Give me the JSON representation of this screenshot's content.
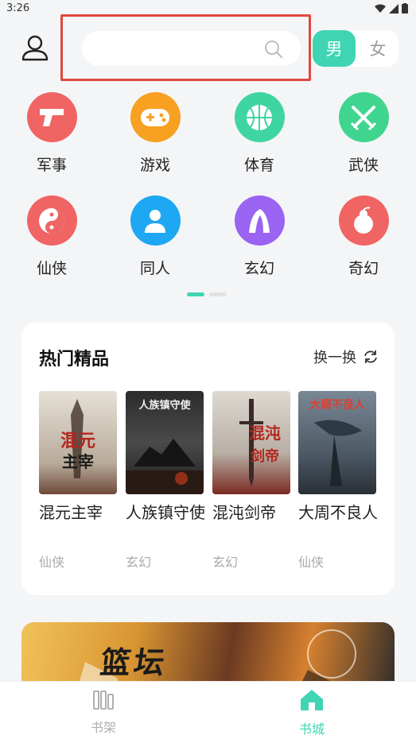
{
  "status": {
    "time": "3:26"
  },
  "header": {
    "search_placeholder": "",
    "gender": {
      "male": "男",
      "female": "女",
      "selected": "男"
    }
  },
  "categories": [
    {
      "label": "军事",
      "color": "#f06464",
      "icon": "gun-icon"
    },
    {
      "label": "游戏",
      "color": "#f7a021",
      "icon": "gamepad-icon"
    },
    {
      "label": "体育",
      "color": "#3fd5a0",
      "icon": "basketball-icon"
    },
    {
      "label": "武侠",
      "color": "#3fd58e",
      "icon": "crossed-swords-icon"
    },
    {
      "label": "仙侠",
      "color": "#f06464",
      "icon": "yin-yang-icon"
    },
    {
      "label": "同人",
      "color": "#1ea7f2",
      "icon": "person-icon"
    },
    {
      "label": "玄幻",
      "color": "#9a63f2",
      "icon": "magic-mountain-icon"
    },
    {
      "label": "奇幻",
      "color": "#f06464",
      "icon": "gourd-icon"
    }
  ],
  "hot": {
    "title": "热门精品",
    "refresh_label": "换一换",
    "books": [
      {
        "title": "混元主宰",
        "tag": "仙侠",
        "cover_text": "混元主宰",
        "cover_color": "#d8d2c8"
      },
      {
        "title": "人族镇守使",
        "tag": "玄幻",
        "cover_text": "人族镇守使",
        "cover_color": "#3a3a3a"
      },
      {
        "title": "混沌剑帝",
        "tag": "玄幻",
        "cover_text": "混沌剑帝",
        "cover_color": "#cfc8c0"
      },
      {
        "title": "大周不良人",
        "tag": "仙侠",
        "cover_text": "大周不良人",
        "cover_color": "#5c6a78"
      }
    ]
  },
  "banner": {
    "text": "篮坛"
  },
  "bottom_nav": {
    "bookshelf": "书架",
    "bookstore": "书城",
    "active": "书城",
    "active_color": "#3fd5b3",
    "inactive_color": "#b0b0b0"
  }
}
